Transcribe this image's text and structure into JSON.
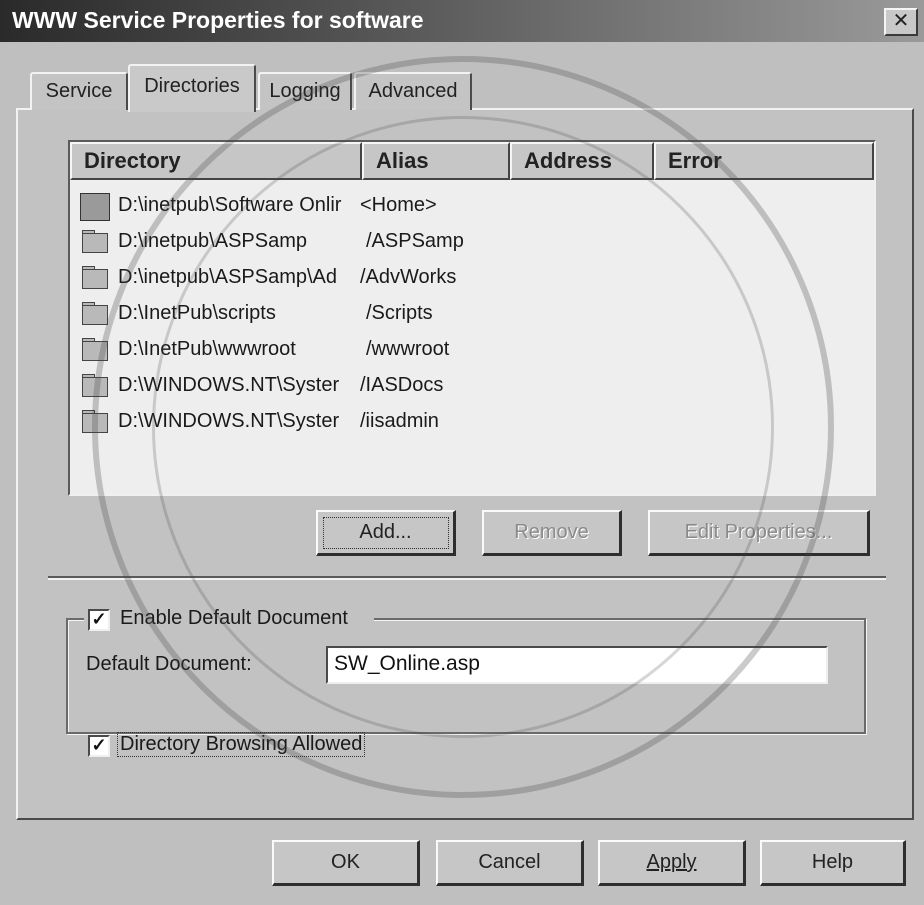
{
  "window": {
    "title": "WWW Service Properties for software",
    "close_glyph": "✕"
  },
  "tabs": [
    {
      "label": "Service",
      "active": false
    },
    {
      "label": "Directories",
      "active": true
    },
    {
      "label": "Logging",
      "active": false
    },
    {
      "label": "Advanced",
      "active": false
    }
  ],
  "directory_list": {
    "columns": [
      "Directory",
      "Alias",
      "Address",
      "Error"
    ],
    "rows": [
      {
        "directory": "D:\\inetpub\\Software Onlir",
        "alias": "<Home>",
        "icon": "home-directory-icon"
      },
      {
        "directory": "D:\\inetpub\\ASPSamp",
        "alias": "/ASPSamp",
        "icon": "folder-icon"
      },
      {
        "directory": "D:\\inetpub\\ASPSamp\\Ad",
        "alias": "/AdvWorks",
        "icon": "folder-icon"
      },
      {
        "directory": "D:\\InetPub\\scripts",
        "alias": "/Scripts",
        "icon": "folder-icon"
      },
      {
        "directory": "D:\\InetPub\\wwwroot",
        "alias": "/wwwroot",
        "icon": "folder-icon"
      },
      {
        "directory": "D:\\WINDOWS.NT\\Syster",
        "alias": "/IASDocs",
        "icon": "folder-icon"
      },
      {
        "directory": "D:\\WINDOWS.NT\\Syster",
        "alias": "/iisadmin",
        "icon": "folder-icon"
      }
    ]
  },
  "list_buttons": {
    "add": "Add...",
    "remove": "Remove",
    "edit_properties": "Edit Properties..."
  },
  "default_document": {
    "enable_label": "Enable Default Document",
    "enable_checked": true,
    "field_label": "Default Document:",
    "value": "SW_Online.asp"
  },
  "directory_browsing": {
    "label": "Directory Browsing Allowed",
    "checked": true
  },
  "dialog_buttons": {
    "ok": "OK",
    "cancel": "Cancel",
    "apply": "Apply",
    "help": "Help"
  },
  "checkmark_glyph": "✓"
}
